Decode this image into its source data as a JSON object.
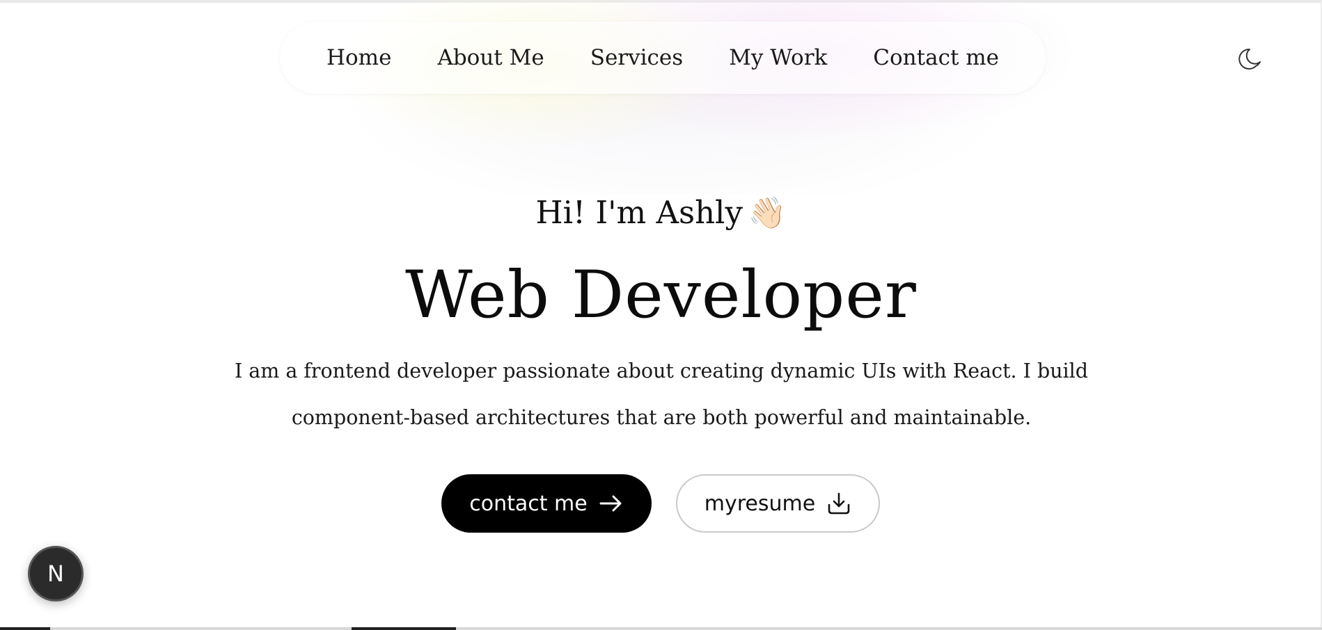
{
  "nav": {
    "items": [
      {
        "label": "Home"
      },
      {
        "label": "About Me"
      },
      {
        "label": "Services"
      },
      {
        "label": "My Work"
      },
      {
        "label": "Contact me"
      }
    ],
    "theme_icon": "moon-icon"
  },
  "hero": {
    "greeting": "Hi! I'm Ashly",
    "wave_emoji": "👋🏻",
    "title": "Web Developer",
    "description_line1": "I am a frontend developer passionate about creating dynamic UIs with React. I build",
    "description_line2": "component-based architectures that are both powerful and maintainable."
  },
  "buttons": {
    "contact_label": "contact me",
    "contact_icon": "arrow-right-icon",
    "resume_label": "myresume",
    "resume_icon": "download-icon"
  },
  "dev_badge": {
    "letter": "N"
  },
  "colors": {
    "primary_button_bg": "#000000",
    "primary_button_text": "#ffffff",
    "text": "#111111"
  }
}
